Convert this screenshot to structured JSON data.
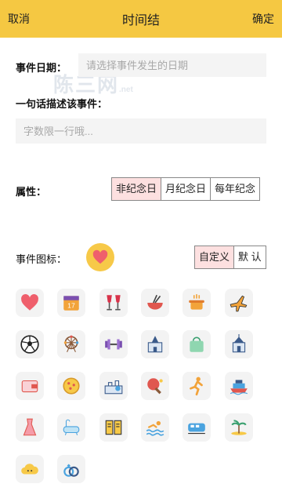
{
  "header": {
    "cancel_label": "取消",
    "title": "时间结",
    "confirm_label": "确定"
  },
  "colors": {
    "header_bg": "#f5c842",
    "active_option_bg": "#fde0e0",
    "input_bg": "#f4f4f4",
    "icon_preview_bg": "#f7c948"
  },
  "form": {
    "date_label": "事件日期：",
    "date_placeholder": "请选择事件发生的日期",
    "desc_label": "一句话描述该事件：",
    "desc_placeholder": "字数限一行哦...",
    "attr_label": "属性：",
    "attr_options": [
      "非纪念日",
      "月纪念日",
      "每年纪念"
    ],
    "attr_selected": "非纪念日",
    "icon_label": "事件图标：",
    "icon_modes": [
      "自定义",
      "默 认"
    ],
    "icon_mode_selected": "自定义"
  },
  "watermark": {
    "text": "陈三网",
    "suffix": ".net"
  },
  "icons": [
    "heart-icon",
    "calendar-icon",
    "wine-glasses-icon",
    "bowl-icon",
    "cooking-pot-icon",
    "airplane-icon",
    "soccer-ball-icon",
    "ferris-wheel-icon",
    "dumbbell-icon",
    "castle-icon",
    "shopping-bag-icon",
    "church-icon",
    "wallet-icon",
    "pizza-icon",
    "map-location-icon",
    "ping-pong-icon",
    "running-person-icon",
    "cruise-ship-icon",
    "dress-icon",
    "bathtub-icon",
    "book-icon",
    "swimming-icon",
    "train-icon",
    "island-icon",
    "cloud-icon",
    "rings-icon"
  ]
}
